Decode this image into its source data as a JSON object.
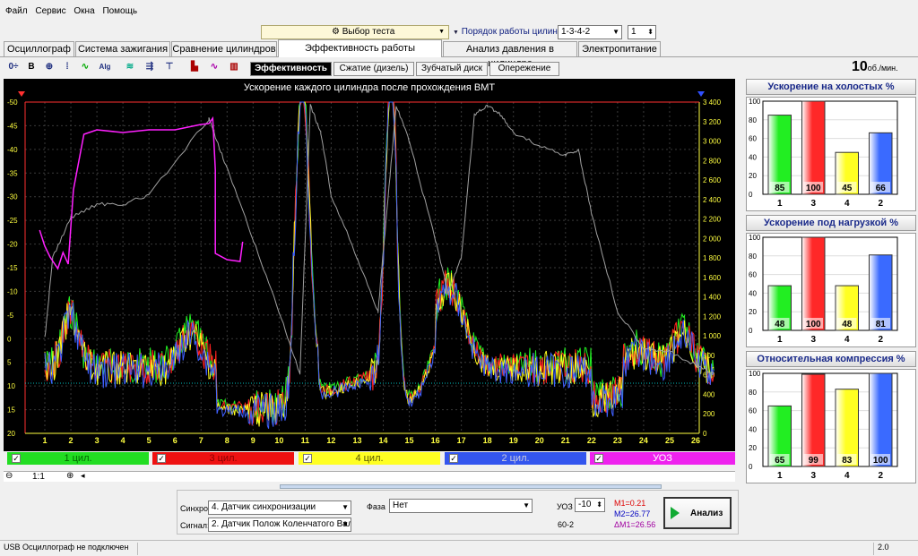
{
  "menu": [
    "Файл",
    "Сервис",
    "Окна",
    "Помощь"
  ],
  "test_selector": {
    "label": "Выбор теста"
  },
  "firing_order": {
    "label": "Порядок работы цилиндров",
    "value": "1-3-4-2",
    "count": "1"
  },
  "tabs": [
    "Осциллограф",
    "Система зажигания",
    "Сравнение цилиндров",
    "Эффективность работы цилиндров",
    "Анализ давления в цилиндре",
    "Электропитание"
  ],
  "modes": [
    "Эффективность",
    "Сжатие (дизель)",
    "Зубчатый диск",
    "Опережение"
  ],
  "rpm": {
    "value": "10",
    "unit": "об./мин."
  },
  "main_chart": {
    "title": "Ускорение каждого цилиндра после прохождения ВМТ",
    "left_ticks": [
      "-50",
      "-45",
      "-40",
      "-35",
      "-30",
      "-25",
      "-20",
      "-15",
      "-10",
      "-5",
      "0",
      "5",
      "10",
      "15",
      "20"
    ],
    "right_ticks": [
      "3 400",
      "3 200",
      "3 000",
      "2 800",
      "2 600",
      "2 400",
      "2 200",
      "2 000",
      "1 800",
      "1 600",
      "1 400",
      "1 200",
      "1 000",
      "800",
      "600",
      "400",
      "200",
      "0"
    ],
    "x_ticks": [
      "1",
      "2",
      "3",
      "4",
      "5",
      "6",
      "7",
      "8",
      "9",
      "10",
      "11",
      "12",
      "13",
      "14",
      "15",
      "16",
      "17",
      "18",
      "19",
      "20",
      "21",
      "22",
      "23",
      "24",
      "25",
      "26"
    ],
    "colors": {
      "green": "#22ee22",
      "red": "#ff2020",
      "yellow": "#ffff20",
      "blue": "#4060ff",
      "magenta": "#ff20ff",
      "gray": "#a0a0a0"
    }
  },
  "channels": [
    {
      "label": "1 цил.",
      "color": "#22dd22",
      "text": "#006600"
    },
    {
      "label": "3 цил.",
      "color": "#ee1111",
      "text": "#880000"
    },
    {
      "label": "4 цил.",
      "color": "#ffff22",
      "text": "#555500"
    },
    {
      "label": "2 цил.",
      "color": "#3355ee",
      "text": "#ccd"
    },
    {
      "label": "УОЗ",
      "color": "#ee22ee",
      "text": "#fff"
    }
  ],
  "scale": "1:1",
  "panels": [
    {
      "title": "Ускорение на холостых %",
      "values": [
        85,
        100,
        45,
        66
      ]
    },
    {
      "title": "Ускорение под нагрузкой %",
      "values": [
        48,
        100,
        48,
        81
      ]
    },
    {
      "title": "Относительная компрессия %",
      "values": [
        65,
        99,
        83,
        100
      ]
    }
  ],
  "bar_labels": [
    "1",
    "3",
    "4",
    "2"
  ],
  "bar_colors": [
    "#22ee22",
    "#ff2828",
    "#ffff22",
    "#3a6aff"
  ],
  "bar_ticks": [
    "100",
    "80",
    "60",
    "40",
    "20",
    "0"
  ],
  "bottom": {
    "sync_label": "Синхро:",
    "sync_value": "4. Датчик синхронизации",
    "signal_label": "Сигнал:",
    "signal_value": "2. Датчик Полож Коленчатого Вал",
    "phase_label": "Фаза",
    "phase_value": "Нет",
    "uoz_label": "УОЗ",
    "uoz_value": "-10",
    "gear": "60-2",
    "m1": "M1=0.21",
    "m2": "M2=26.77",
    "dm1": "ΔM1=26.56",
    "analyze": "Анализ"
  },
  "status": {
    "left": "USB Осциллограф не подключен",
    "right": "2.0"
  }
}
